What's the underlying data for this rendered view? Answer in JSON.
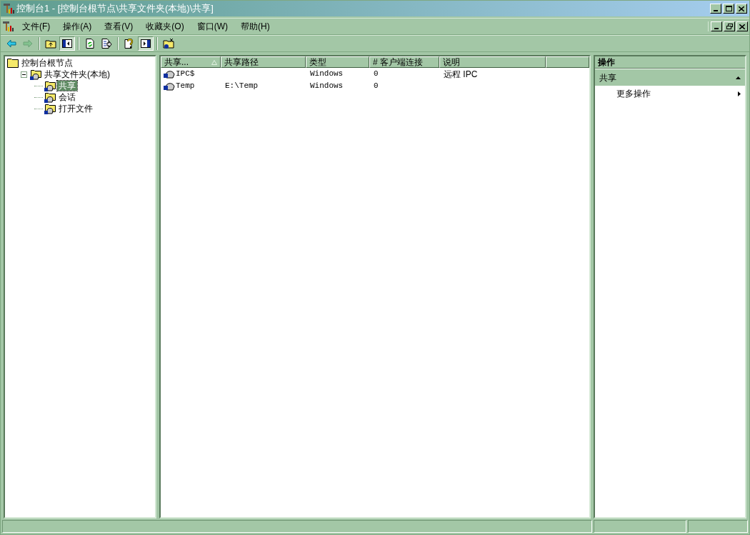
{
  "window": {
    "title": "控制台1 - [控制台根节点\\共享文件夹(本地)\\共享]"
  },
  "menu": [
    {
      "label": "文件(F)"
    },
    {
      "label": "操作(A)"
    },
    {
      "label": "查看(V)"
    },
    {
      "label": "收藏夹(O)"
    },
    {
      "label": "窗口(W)"
    },
    {
      "label": "帮助(H)"
    }
  ],
  "toolbar": [
    {
      "kind": "back",
      "disabled": false,
      "pressed": false
    },
    {
      "kind": "forward",
      "disabled": true,
      "pressed": false
    },
    {
      "kind": "sep"
    },
    {
      "kind": "up",
      "disabled": false,
      "pressed": false
    },
    {
      "kind": "tree",
      "disabled": false,
      "pressed": true
    },
    {
      "kind": "sep"
    },
    {
      "kind": "refresh",
      "disabled": false,
      "pressed": false
    },
    {
      "kind": "export",
      "disabled": false,
      "pressed": false
    },
    {
      "kind": "sep"
    },
    {
      "kind": "help",
      "disabled": false,
      "pressed": false
    },
    {
      "kind": "actionpane",
      "disabled": false,
      "pressed": true
    },
    {
      "kind": "sep"
    },
    {
      "kind": "newwindow",
      "disabled": false,
      "pressed": false
    }
  ],
  "tree": [
    {
      "label": "控制台根节点",
      "kind": "folder",
      "selected": false,
      "children": [
        {
          "label": "共享文件夹(本地)",
          "kind": "share",
          "selected": false,
          "expanded": true,
          "children": [
            {
              "label": "共享",
              "kind": "share",
              "selected": true
            },
            {
              "label": "会话",
              "kind": "share",
              "selected": false
            },
            {
              "label": "打开文件",
              "kind": "share",
              "selected": false
            }
          ]
        }
      ]
    }
  ],
  "table": {
    "columns": [
      {
        "label": "共享...",
        "sorted": true
      },
      {
        "label": "共享路径",
        "sorted": false
      },
      {
        "label": "类型",
        "sorted": false
      },
      {
        "label": "# 客户端连接",
        "sorted": false
      },
      {
        "label": "说明",
        "sorted": false
      }
    ],
    "rows": [
      [
        "IPC$",
        "",
        "Windows",
        "0",
        "远程 IPC"
      ],
      [
        "Temp",
        "E:\\Temp",
        "Windows",
        "0",
        ""
      ]
    ]
  },
  "actions": {
    "title": "操作",
    "section": {
      "label": "共享",
      "expanded": true
    },
    "items": [
      {
        "label": "更多操作"
      }
    ]
  }
}
